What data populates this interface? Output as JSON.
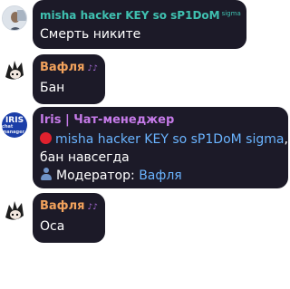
{
  "messages": [
    {
      "author": "misha hacker KEY so sP1DoM",
      "author_suffix": "sigma",
      "text": "Смерть никите",
      "avatar": "profile-photo"
    },
    {
      "author": "Вафля",
      "author_badge": "♪♪",
      "text": "Бан",
      "avatar": "anime-character-avatar"
    },
    {
      "author": "Iris | Чат-менеджер",
      "avatar_text": "IRIS",
      "avatar_subtext": "chat manager",
      "action_icon": "red-circle",
      "target_user": "misha hacker KEY so sP1DoM sigma",
      "action_text": "бан навсегда",
      "moderator_icon": "user-silhouette",
      "moderator_label": "Модератор:",
      "moderator_name": "Вафля"
    },
    {
      "author": "Вафля",
      "author_badge": "♪♪",
      "text": "Оса",
      "avatar": "anime-character-avatar"
    }
  ]
}
